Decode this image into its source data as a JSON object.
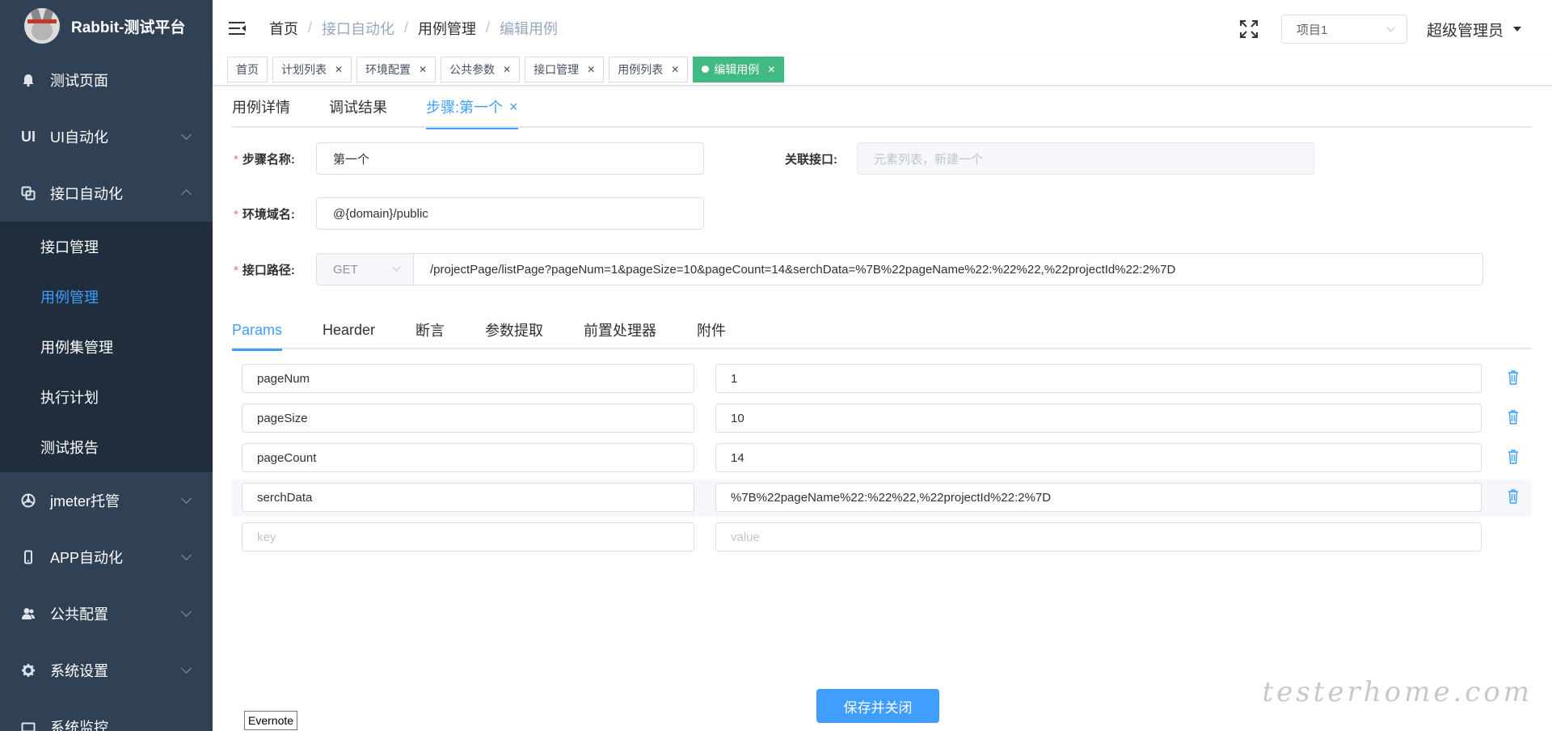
{
  "app": {
    "title": "Rabbit-测试平台"
  },
  "sidebar": {
    "items": [
      {
        "label": "测试页面",
        "icon": "bell-icon"
      },
      {
        "label": "UI自动化",
        "icon_text": "UI"
      },
      {
        "label": "接口自动化",
        "icon": "copy-icon",
        "expanded": true,
        "children": [
          {
            "label": "接口管理"
          },
          {
            "label": "用例管理",
            "active": true
          },
          {
            "label": "用例集管理"
          },
          {
            "label": "执行计划"
          },
          {
            "label": "测试报告"
          }
        ]
      },
      {
        "label": "jmeter托管",
        "icon": "aperture-icon"
      },
      {
        "label": "APP自动化",
        "icon": "mobile-icon"
      },
      {
        "label": "公共配置",
        "icon": "users-icon"
      },
      {
        "label": "系统设置",
        "icon": "gear-icon"
      },
      {
        "label": "系统监控",
        "icon": "monitor-icon"
      }
    ]
  },
  "header": {
    "breadcrumb": [
      "首页",
      "接口自动化",
      "用例管理",
      "编辑用例"
    ],
    "project": "项目1",
    "user": "超级管理员"
  },
  "tags": [
    {
      "label": "首页",
      "closable": false
    },
    {
      "label": "计划列表",
      "closable": true
    },
    {
      "label": "环境配置",
      "closable": true
    },
    {
      "label": "公共参数",
      "closable": true
    },
    {
      "label": "接口管理",
      "closable": true
    },
    {
      "label": "用例列表",
      "closable": true
    },
    {
      "label": "编辑用例",
      "closable": true,
      "active": true
    }
  ],
  "case_tabs": [
    {
      "label": "用例详情"
    },
    {
      "label": "调试结果"
    },
    {
      "label": "步骤:第一个",
      "active": true,
      "closable": true
    }
  ],
  "form": {
    "step_name_label": "步骤名称:",
    "step_name": "第一个",
    "related_api_label": "关联接口:",
    "related_api_placeholder": "元素列表，新建一个",
    "env_domain_label": "环境域名:",
    "env_domain": "@{domain}/public",
    "api_path_label": "接口路径:",
    "method": "GET",
    "api_path": "/projectPage/listPage?pageNum=1&pageSize=10&pageCount=14&serchData=%7B%22pageName%22:%22%22,%22projectId%22:2%7D"
  },
  "request_tabs": [
    {
      "label": "Params",
      "active": true
    },
    {
      "label": "Hearder"
    },
    {
      "label": "断言"
    },
    {
      "label": "参数提取"
    },
    {
      "label": "前置处理器"
    },
    {
      "label": "附件"
    }
  ],
  "params": [
    {
      "key": "pageNum",
      "value": "1"
    },
    {
      "key": "pageSize",
      "value": "10"
    },
    {
      "key": "pageCount",
      "value": "14"
    },
    {
      "key": "serchData",
      "value": "%7B%22pageName%22:%22%22,%22projectId%22:2%7D"
    }
  ],
  "new_param": {
    "key_placeholder": "key",
    "value_placeholder": "value"
  },
  "save_button": "保存并关闭",
  "tooltip": "Evernote",
  "watermark": "testerhome.com",
  "colors": {
    "primary": "#409eff",
    "sidebar": "#304156",
    "tag_active": "#42b983"
  }
}
